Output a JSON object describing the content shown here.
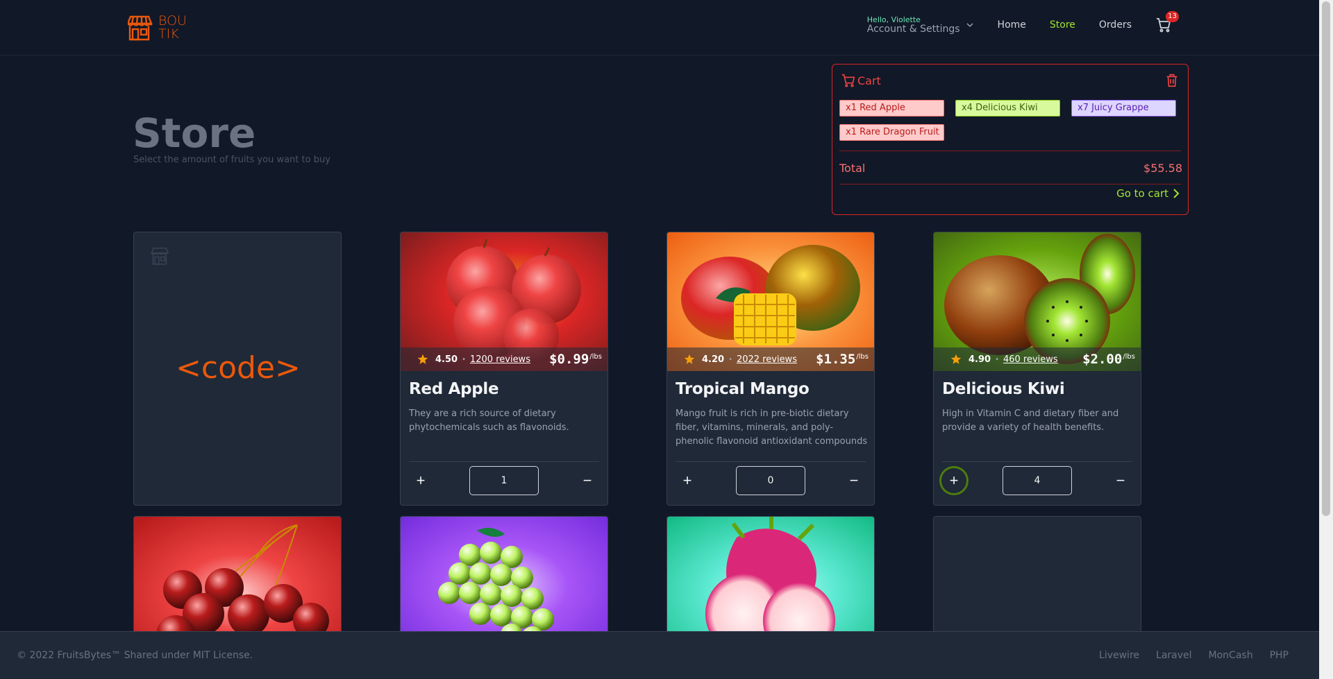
{
  "header": {
    "logo_top": "BOU",
    "logo_bottom": "TIK",
    "account_greeting": "Hello, Violette",
    "account_label": "Account & Settings",
    "nav": [
      {
        "label": "Home",
        "active": false
      },
      {
        "label": "Store",
        "active": true
      },
      {
        "label": "Orders",
        "active": false
      }
    ],
    "cart_count": "13"
  },
  "page": {
    "title": "Store",
    "subtitle": "Select the amount of fruits you want to buy"
  },
  "cart": {
    "title": "Cart",
    "items": [
      {
        "label": "x1 Red Apple",
        "color": "red"
      },
      {
        "label": "x4 Delicious Kiwi",
        "color": "green"
      },
      {
        "label": "x7 Juicy Grappe",
        "color": "violet"
      },
      {
        "label": "x1 Rare Dragon Fruit",
        "color": "red"
      }
    ],
    "total_label": "Total",
    "total_value": "$55.58",
    "go_to_cart": "Go to cart"
  },
  "placeholder_card": {
    "code_text": "<code>"
  },
  "products": [
    {
      "name": "Red Apple",
      "description": "They are a rich source of dietary phytochemicals such as flavonoids.",
      "rating": "4.50",
      "reviews": "1200 reviews",
      "price": "$0.99",
      "unit": "/lbs",
      "quantity": "1",
      "plus": "+",
      "minus": "−"
    },
    {
      "name": "Tropical Mango",
      "description": "Mango fruit is rich in pre-biotic dietary fiber, vitamins, minerals, and poly-phenolic flavonoid antioxidant compounds",
      "rating": "4.20",
      "reviews": "2022 reviews",
      "price": "$1.35",
      "unit": "/lbs",
      "quantity": "0",
      "plus": "+",
      "minus": "−"
    },
    {
      "name": "Delicious Kiwi",
      "description": "High in Vitamin C and dietary fiber and provide a variety of health benefits.",
      "rating": "4.90",
      "reviews": "460 reviews",
      "price": "$2.00",
      "unit": "/lbs",
      "quantity": "4",
      "plus": "+",
      "minus": "−"
    }
  ],
  "footer": {
    "copyright": "© 2022 FruitsBytes™ Shared under MIT License.",
    "links": [
      "Livewire",
      "Laravel",
      "MonCash",
      "PHP"
    ]
  }
}
